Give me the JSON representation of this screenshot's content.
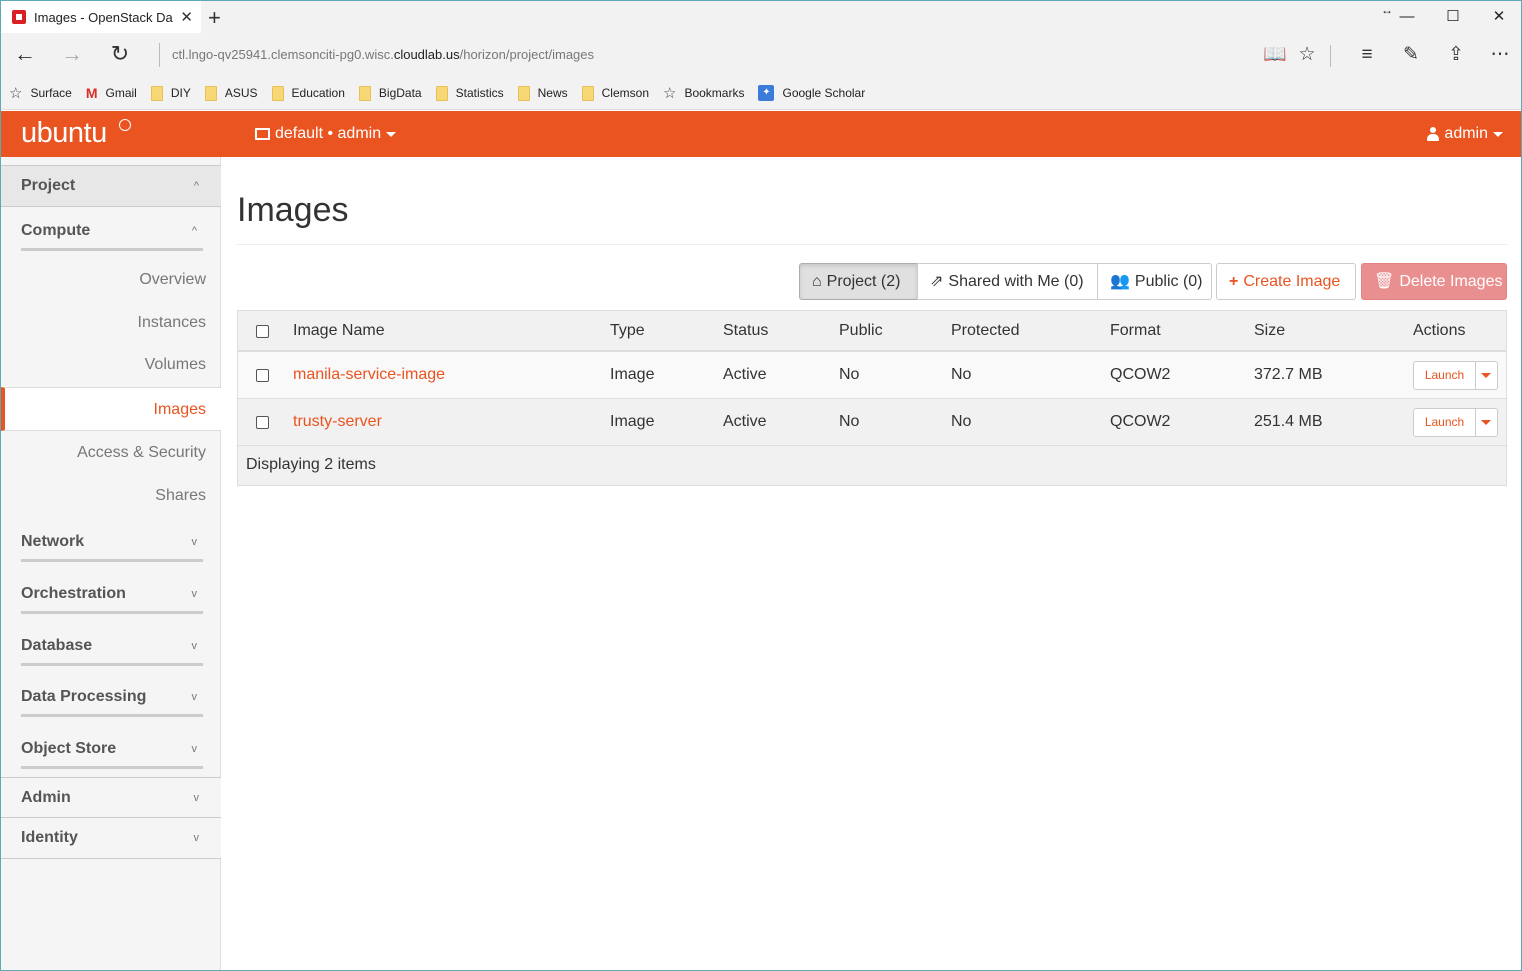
{
  "browser": {
    "tab_title": "Images - OpenStack Da",
    "tab_close": "✕",
    "new_tab": "+",
    "url_prefix": "ctl.lngo-qv25941.clemsonciti-pg0.wisc.",
    "url_domain": "cloudlab.us",
    "url_path": "/horizon/project/images",
    "favorites": [
      {
        "label": "Surface",
        "icon": "star-icon"
      },
      {
        "label": "Gmail",
        "icon": "gmail-icon"
      },
      {
        "label": "DIY",
        "icon": "folder-icon"
      },
      {
        "label": "ASUS",
        "icon": "folder-icon"
      },
      {
        "label": "Education",
        "icon": "folder-icon"
      },
      {
        "label": "BigData",
        "icon": "folder-icon"
      },
      {
        "label": "Statistics",
        "icon": "folder-icon"
      },
      {
        "label": "News",
        "icon": "folder-icon"
      },
      {
        "label": "Clemson",
        "icon": "folder-icon"
      },
      {
        "label": "Bookmarks",
        "icon": "star-icon"
      },
      {
        "label": "Google Scholar",
        "icon": "scholar-icon"
      }
    ]
  },
  "header": {
    "logo": "ubuntu",
    "project_switcher": "default • admin",
    "user": "admin",
    "brand_color": "#e95420"
  },
  "sidebar": {
    "project": "Project",
    "compute": "Compute",
    "items": [
      "Overview",
      "Instances",
      "Volumes",
      "Images",
      "Access & Security",
      "Shares"
    ],
    "active_item": "Images",
    "groups": [
      "Network",
      "Orchestration",
      "Database",
      "Data Processing",
      "Object Store"
    ],
    "admin": "Admin",
    "identity": "Identity"
  },
  "main": {
    "title": "Images",
    "filters": {
      "project": "Project (2)",
      "shared": "Shared with Me (0)",
      "public": "Public (0)"
    },
    "create_button": "Create Image",
    "delete_button": "Delete Images",
    "table": {
      "columns": [
        "Image Name",
        "Type",
        "Status",
        "Public",
        "Protected",
        "Format",
        "Size",
        "Actions"
      ],
      "rows": [
        {
          "name": "manila-service-image",
          "type": "Image",
          "status": "Active",
          "public": "No",
          "protected": "No",
          "format": "QCOW2",
          "size": "372.7 MB",
          "action": "Launch"
        },
        {
          "name": "trusty-server",
          "type": "Image",
          "status": "Active",
          "public": "No",
          "protected": "No",
          "format": "QCOW2",
          "size": "251.4 MB",
          "action": "Launch"
        }
      ],
      "footer": "Displaying 2 items"
    }
  }
}
